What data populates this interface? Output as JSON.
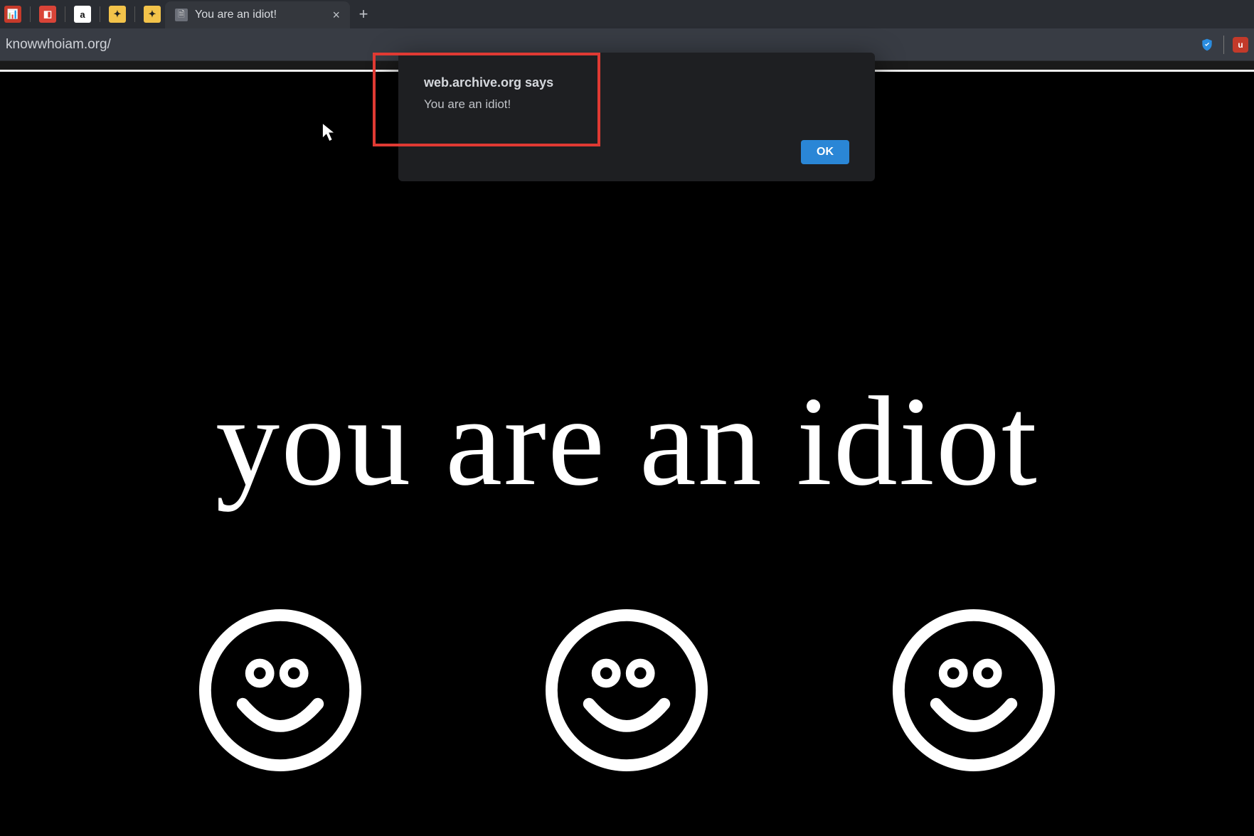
{
  "browser": {
    "tab_title": "You are an idiot!",
    "url": "knowwhoiam.org/",
    "new_tab_label": "+",
    "close_tab_label": "×"
  },
  "page": {
    "headline": "you are an idiot",
    "smiley_icon_name": "smiley-face-icon"
  },
  "alert": {
    "title": "web.archive.org says",
    "message": "You are an idiot!",
    "ok_label": "OK"
  },
  "colors": {
    "highlight_border": "#e03a33",
    "alert_button": "#2a86d6",
    "page_bg": "#000000",
    "page_fg": "#ffffff"
  }
}
